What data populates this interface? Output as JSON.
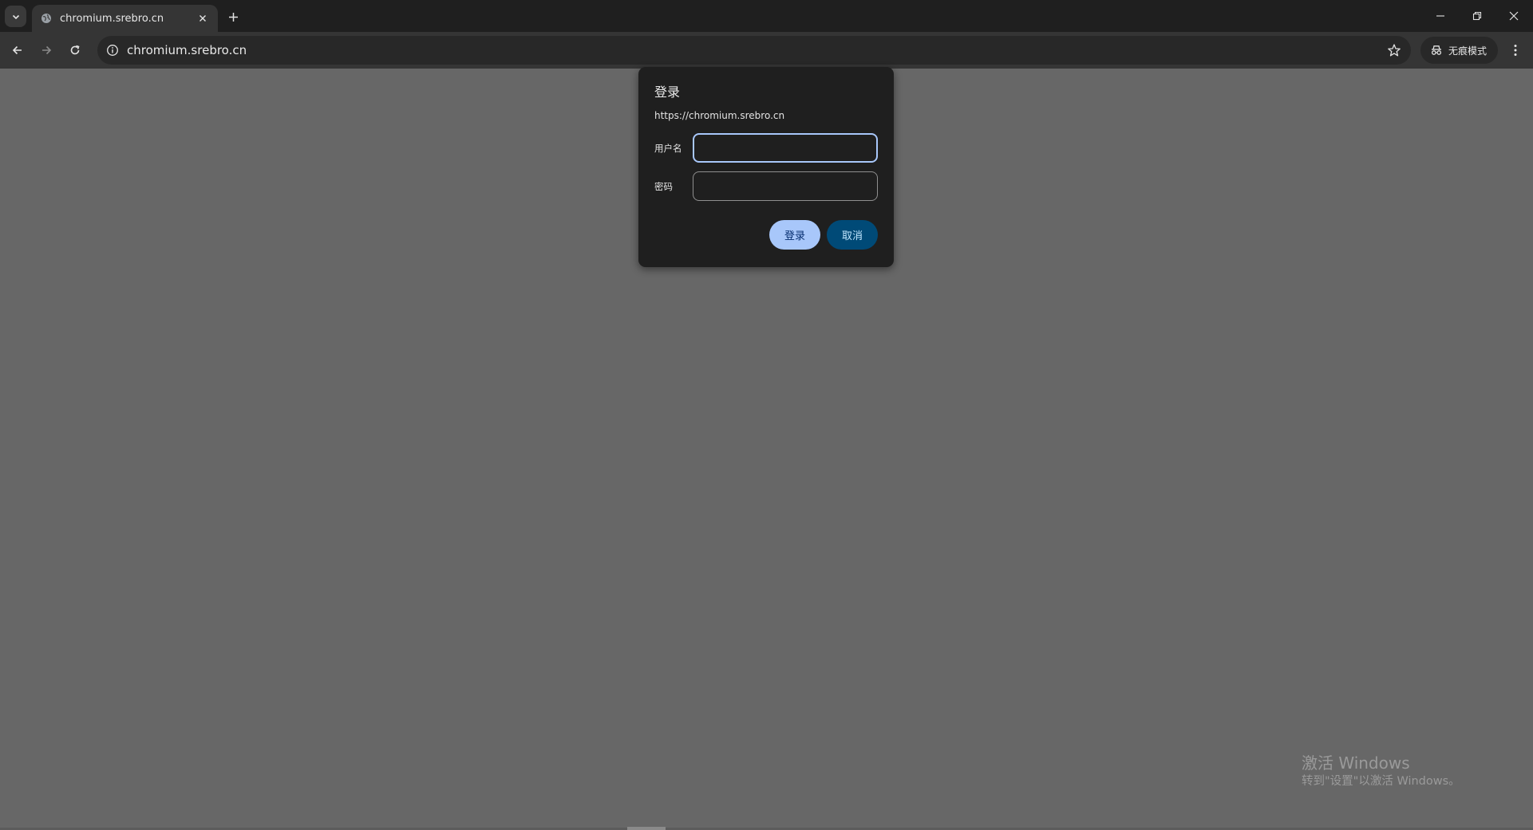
{
  "browser": {
    "tab": {
      "title": "chromium.srebro.cn"
    },
    "omnibox": {
      "url": "chromium.srebro.cn"
    },
    "incognito": {
      "label": "无痕模式"
    },
    "icons": {
      "tab_search": "chevron-down-icon",
      "favicon": "globe-icon",
      "tab_close": "close-icon",
      "new_tab": "plus-icon",
      "minimize": "minimize-icon",
      "restore": "restore-icon",
      "window_close": "close-icon",
      "back": "arrow-left-icon",
      "forward": "arrow-right-icon",
      "reload": "reload-icon",
      "site_info": "info-icon",
      "bookmark": "star-icon",
      "incognito": "incognito-icon",
      "menu": "kebab-menu-icon"
    }
  },
  "auth_dialog": {
    "title": "登录",
    "origin": "https://chromium.srebro.cn",
    "username_label": "用户名",
    "username_value": "",
    "password_label": "密码",
    "password_value": "",
    "login_button": "登录",
    "cancel_button": "取消"
  },
  "watermark": {
    "title": "激活 Windows",
    "subtitle": "转到\"设置\"以激活 Windows。"
  },
  "colors": {
    "page_background": "#676767",
    "tabstrip": "#1f1f1f",
    "toolbar": "#353535",
    "dialog": "#1f1f1f",
    "primary_button": "#a8c7fa",
    "secondary_button": "#004a77",
    "focus_ring": "#a8c7fa"
  }
}
